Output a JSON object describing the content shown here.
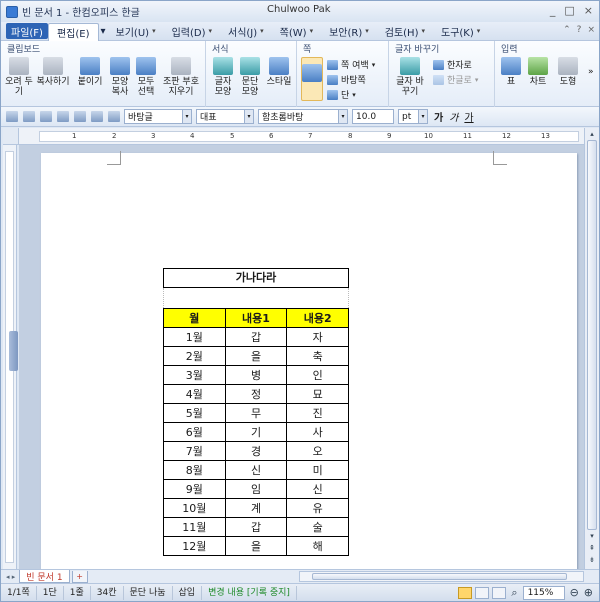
{
  "window": {
    "doc_title": "빈 문서 1 - 한컴오피스 한글",
    "user": "Chulwoo Pak",
    "controls": [
      "_",
      "□",
      "×"
    ]
  },
  "menus": [
    {
      "label": "파일(F)",
      "type": "file"
    },
    {
      "label": "편집(E)",
      "type": "active"
    },
    {
      "label": "보기(U)",
      "type": "normal"
    },
    {
      "label": "입력(D)",
      "type": "normal"
    },
    {
      "label": "서식(J)",
      "type": "normal"
    },
    {
      "label": "쪽(W)",
      "type": "normal"
    },
    {
      "label": "보안(R)",
      "type": "normal"
    },
    {
      "label": "검토(H)",
      "type": "normal"
    },
    {
      "label": "도구(K)",
      "type": "normal"
    }
  ],
  "menubar_right": [
    "?",
    "×"
  ],
  "ribbon": {
    "clipboard": {
      "title": "클립보드",
      "buttons": [
        "오려 두기",
        "복사하기",
        "붙이기",
        "모양 복사",
        "모두 선택",
        "조판 부호 지우기"
      ]
    },
    "format": {
      "title": "서식",
      "buttons": [
        "글자 모양",
        "문단 모양",
        "스타일"
      ]
    },
    "page": {
      "title": "쪽",
      "items": [
        "쪽 여백",
        "바탕쪽",
        "단"
      ]
    },
    "char_change": {
      "title": "글자 바꾸기",
      "big": "글자 바꾸기",
      "items": [
        "한자로",
        "한글로"
      ]
    },
    "input": {
      "title": "입력",
      "buttons": [
        "표",
        "차트",
        "도형"
      ]
    }
  },
  "toolbar": {
    "style": "바탕글",
    "lang": "대표",
    "font": "함초롬바탕",
    "size": "10.0",
    "unit": "pt",
    "format_buttons": [
      "가",
      "가",
      "가"
    ]
  },
  "ruler_numbers": [
    "1",
    "2",
    "3",
    "4",
    "5",
    "6",
    "7",
    "8",
    "9",
    "10",
    "11",
    "12",
    "13"
  ],
  "document": {
    "caption": "가나다라",
    "headers": [
      "월",
      "내용1",
      "내용2"
    ],
    "rows": [
      [
        "1월",
        "갑",
        "자"
      ],
      [
        "2월",
        "을",
        "축"
      ],
      [
        "3월",
        "병",
        "인"
      ],
      [
        "4월",
        "정",
        "묘"
      ],
      [
        "5월",
        "무",
        "진"
      ],
      [
        "6월",
        "기",
        "사"
      ],
      [
        "7월",
        "경",
        "오"
      ],
      [
        "8월",
        "신",
        "미"
      ],
      [
        "9월",
        "임",
        "신"
      ],
      [
        "10월",
        "계",
        "유"
      ],
      [
        "11월",
        "갑",
        "술"
      ],
      [
        "12월",
        "을",
        "해"
      ]
    ],
    "header_color": "#ffff00"
  },
  "tabs": {
    "doc_tab": "빈 문서 1",
    "add": "+"
  },
  "status": {
    "page": "1/1쪽",
    "column": "1단",
    "line": "1줄",
    "col": "34칸",
    "section": "문단 나눔",
    "mode": "삽입",
    "track": "변경 내용 [기록 중지]",
    "zoom": "115%"
  }
}
